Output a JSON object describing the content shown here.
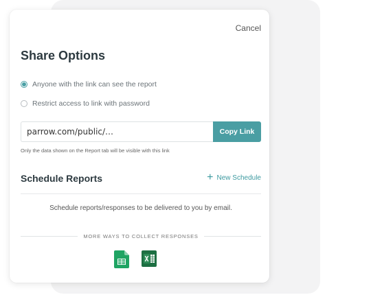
{
  "modal": {
    "cancel_label": "Cancel",
    "title": "Share Options"
  },
  "access": {
    "options": [
      {
        "label": "Anyone with the link can see the report",
        "selected": true
      },
      {
        "label": "Restrict access to link with password",
        "selected": false
      }
    ]
  },
  "link": {
    "value": "parrow.com/public/…",
    "copy_label": "Copy Link",
    "hint": "Only the data shown on the Report tab will be visible with this link"
  },
  "schedule": {
    "title": "Schedule Reports",
    "new_label": "New Schedule",
    "description": "Schedule reports/responses to be delivered to you by email."
  },
  "collect": {
    "heading": "MORE WAYS TO COLLECT RESPONSES",
    "icons": [
      "google-sheets-icon",
      "excel-icon"
    ]
  },
  "colors": {
    "accent": "#4a9ea3",
    "sheets_green": "#1fa463",
    "excel_green": "#1d6f42"
  }
}
